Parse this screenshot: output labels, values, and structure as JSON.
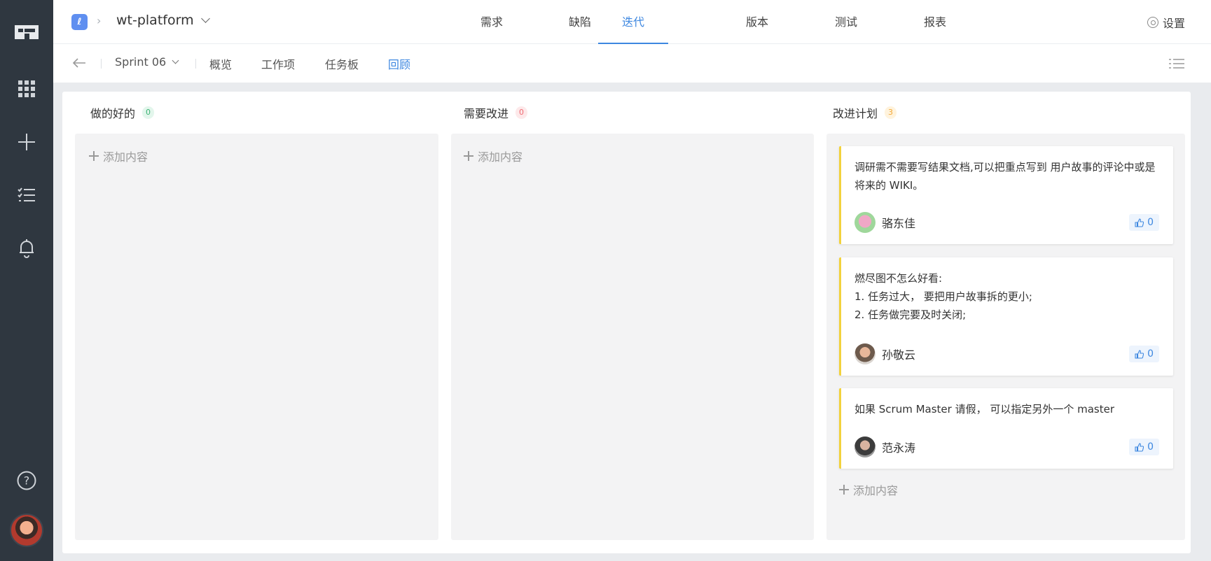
{
  "project": {
    "name": "wt-platform",
    "logo_glyph": "ℓ"
  },
  "main_tabs": [
    {
      "label": "需求"
    },
    {
      "label": "缺陷"
    },
    {
      "label": "迭代",
      "active": true
    },
    {
      "label": "版本"
    },
    {
      "label": "测试"
    },
    {
      "label": "报表"
    }
  ],
  "settings_label": "设置",
  "subbar": {
    "sprint": "Sprint 06",
    "tabs": [
      {
        "label": "概览"
      },
      {
        "label": "工作项"
      },
      {
        "label": "任务板"
      },
      {
        "label": "回顾",
        "active": true
      }
    ]
  },
  "columns": [
    {
      "title": "做的好的",
      "count": "0",
      "badge_color": "#3bb273",
      "add_label": "添加内容",
      "cards": []
    },
    {
      "title": "需要改进",
      "count": "0",
      "badge_color": "#ef6b73",
      "add_label": "添加内容",
      "cards": []
    },
    {
      "title": "改进计划",
      "count": "3",
      "badge_color": "#f3a93a",
      "add_label": "添加内容",
      "cards": [
        {
          "text": "调研需不需要写结果文档,可以把重点写到 用户故事的评论中或是将来的 WIKI。",
          "author": "骆东佳",
          "likes": "0"
        },
        {
          "text_lines": [
            "燃尽图不怎么好看:",
            "1. 任务过大， 要把用户故事拆的更小;",
            "2. 任务做完要及时关闭;"
          ],
          "author": "孙敬云",
          "likes": "0"
        },
        {
          "text": "如果 Scrum Master 请假， 可以指定另外一个 master",
          "author": "范永涛",
          "likes": "0"
        }
      ]
    }
  ],
  "colors": {
    "accent": "#3d87e0",
    "rail": "#2f3740",
    "card_accent": "#f2d23c"
  }
}
